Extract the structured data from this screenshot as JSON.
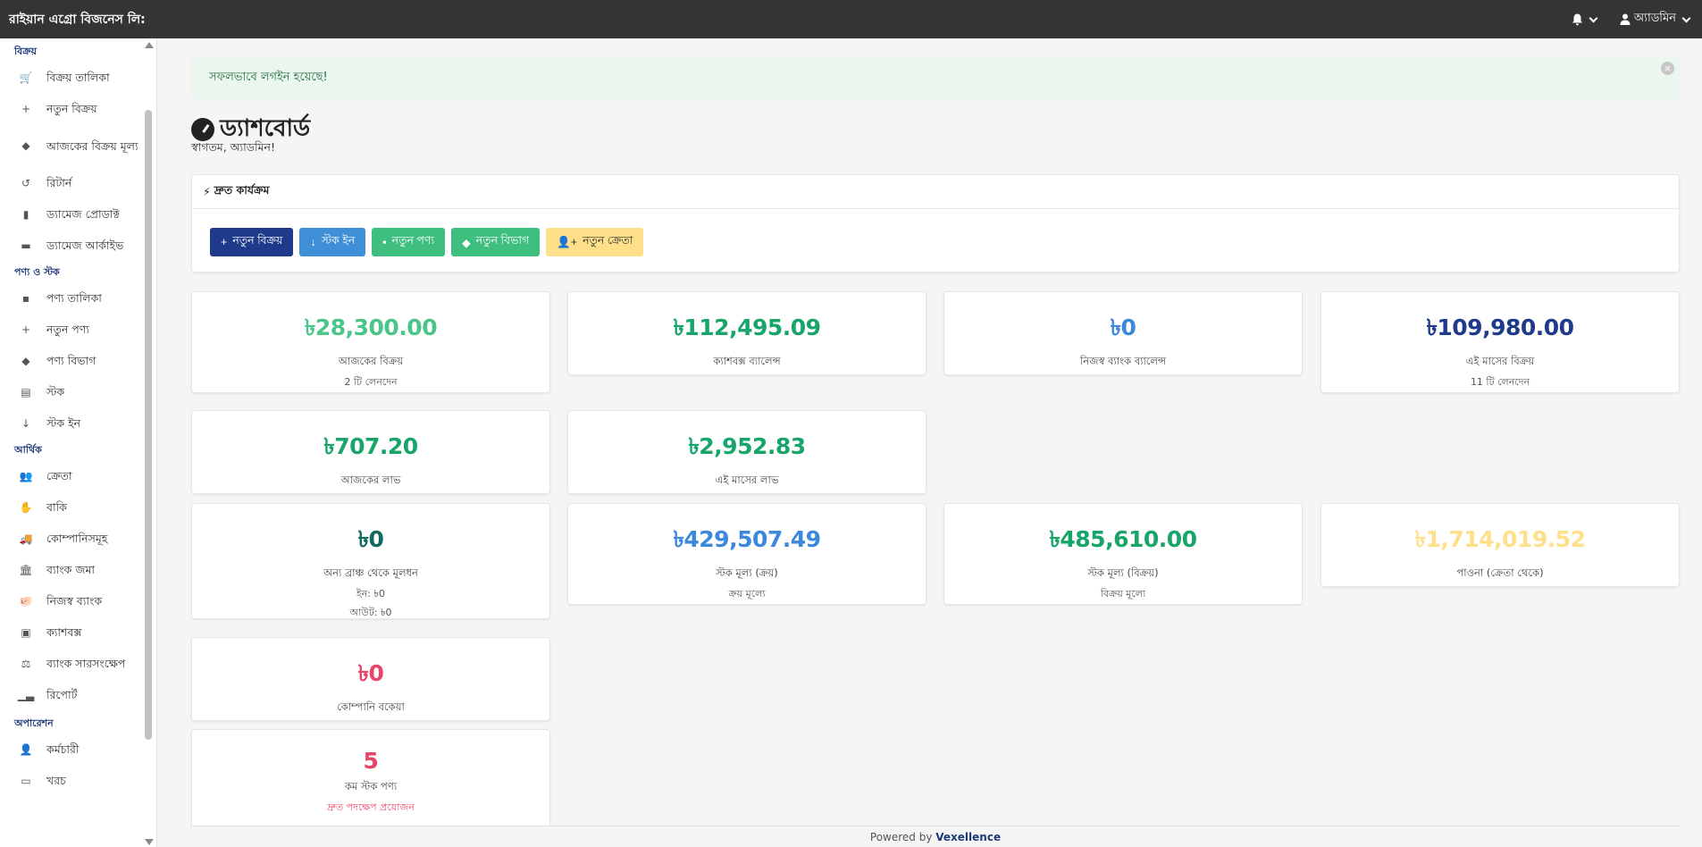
{
  "navbar": {
    "brand": "রাইয়ান এগ্রো বিজনেস লি:",
    "user": "অ্যাডমিন"
  },
  "sidebar": {
    "sections": [
      {
        "title": "বিক্রয়",
        "items": [
          {
            "label": "বিক্রয় তালিকা",
            "icon": "cart-icon"
          },
          {
            "label": "নতুন বিক্রয়",
            "icon": "plus-icon"
          },
          {
            "label": "আজকের বিক্রয় মূল্য",
            "icon": "tag-icon"
          },
          {
            "label": "রিটার্ন",
            "icon": "undo-icon"
          },
          {
            "label": "ড্যামেজ প্রোডাক্ট",
            "icon": "file-icon"
          },
          {
            "label": "ড্যামেজ আর্কাইভ",
            "icon": "archive-icon"
          }
        ]
      },
      {
        "title": "পণ্য ও স্টক",
        "items": [
          {
            "label": "পণ্য তালিকা",
            "icon": "box-icon"
          },
          {
            "label": "নতুন পণ্য",
            "icon": "plus-icon"
          },
          {
            "label": "পণ্য বিভাগ",
            "icon": "tags-icon"
          },
          {
            "label": "স্টক",
            "icon": "warehouse-icon"
          },
          {
            "label": "স্টক ইন",
            "icon": "arrow-down-icon"
          }
        ]
      },
      {
        "title": "আর্থিক",
        "items": [
          {
            "label": "ক্রেতা",
            "icon": "users-icon"
          },
          {
            "label": "বাকি",
            "icon": "hand-coin-icon"
          },
          {
            "label": "কোম্পানিসমূহ",
            "icon": "truck-icon"
          },
          {
            "label": "ব্যাংক জমা",
            "icon": "bank-icon"
          },
          {
            "label": "নিজস্ব ব্যাংক",
            "icon": "piggy-bank-icon"
          },
          {
            "label": "ক্যাশবক্স",
            "icon": "cash-register-icon"
          },
          {
            "label": "ব্যাংক সারসংক্ষেপ",
            "icon": "scale-icon"
          },
          {
            "label": "রিপোর্ট",
            "icon": "chart-icon"
          }
        ]
      },
      {
        "title": "অপারেশন",
        "items": [
          {
            "label": "কর্মচারী",
            "icon": "user-icon"
          },
          {
            "label": "খরচ",
            "icon": "money-icon"
          }
        ]
      }
    ]
  },
  "alert": {
    "text": "সফলভাবে লগইন হয়েছে!"
  },
  "page": {
    "title": "ড্যাশবোর্ড",
    "welcome": "স্বাগতম, অ্যাডমিন!"
  },
  "quick_actions": {
    "title": "দ্রুত কার্যক্রম",
    "buttons": [
      {
        "label": "নতুন বিক্রয়"
      },
      {
        "label": "স্টক ইন"
      },
      {
        "label": "নতুন পণ্য"
      },
      {
        "label": "নতুন বিভাগ"
      },
      {
        "label": "নতুন ক্রেতা"
      }
    ]
  },
  "stats": [
    {
      "value": "৳28,300.00",
      "label": "আজকের বিক্রয়",
      "sub": "2 টি লেনদেন",
      "color": "#4cc58a"
    },
    {
      "value": "৳112,495.09",
      "label": "ক্যাশবক্স ব্যালেন্স",
      "color": "#17a56a"
    },
    {
      "value": "৳0",
      "label": "নিজস্ব ব্যাংক ব্যালেন্স",
      "color": "#3b88dc"
    },
    {
      "value": "৳109,980.00",
      "label": "এই মাসের বিক্রয়",
      "sub": "11 টি লেনদেন",
      "color": "#1f3a8a"
    },
    {
      "value": "৳707.20",
      "label": "আজকের লাভ",
      "color": "#17a56a"
    },
    {
      "value": "৳2,952.83",
      "label": "এই মাসের লাভ",
      "color": "#17a56a"
    },
    {
      "value": "৳0",
      "label": "অন্য ব্রাঞ্চ থেকে মূলধন",
      "sub": "ইন: ৳0",
      "sub2": "আউট: ৳0",
      "color": "#116a5e"
    },
    {
      "value": "৳429,507.49",
      "label": "স্টক মূল্য (ক্রয়)",
      "sub": "ক্রয় মূল্যে",
      "color": "#3b88dc"
    },
    {
      "value": "৳485,610.00",
      "label": "স্টক মূল্য (বিক্রয়)",
      "sub": "বিক্রয় মূল্যে",
      "color": "#17a56a"
    },
    {
      "value": "৳1,714,019.52",
      "label": "পাওনা (ক্রেতা থেকে)",
      "color": "#ffe08a"
    },
    {
      "value": "৳0",
      "label": "কোম্পানি বকেয়া",
      "color": "#e8456a"
    },
    {
      "value": "5",
      "label": "কম স্টক পণ্য",
      "sub": "দ্রুত পদক্ষেপ প্রয়োজন",
      "color": "#e8456a",
      "sub_color": "#e8456a"
    }
  ],
  "footer": {
    "prefix": "Powered by",
    "brand": "Vexellence"
  }
}
